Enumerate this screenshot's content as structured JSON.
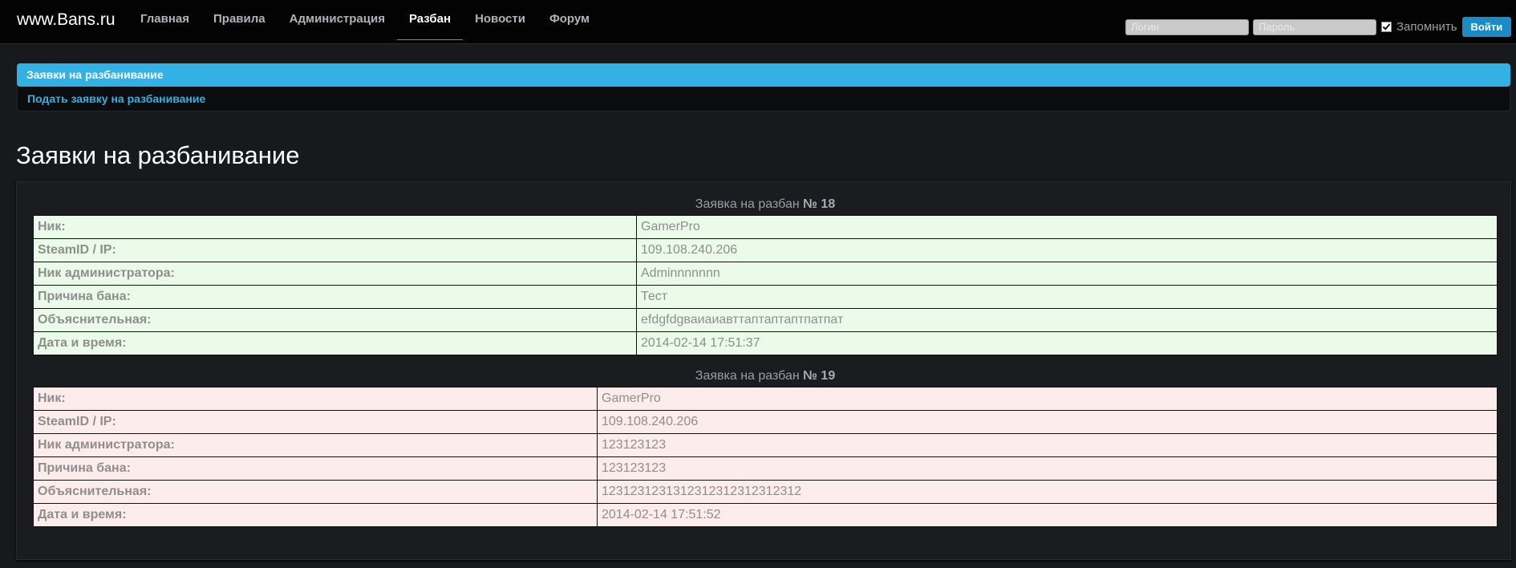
{
  "navbar": {
    "brand": "www.Bans.ru",
    "items": [
      {
        "label": "Главная"
      },
      {
        "label": "Правила"
      },
      {
        "label": "Администрация"
      },
      {
        "label": "Разбан"
      },
      {
        "label": "Новости"
      },
      {
        "label": "Форум"
      }
    ],
    "active": "Разбан",
    "login": {
      "login_placeholder": "Логин",
      "password_placeholder": "Пароль",
      "remember_label": "Запомнить",
      "remember_checked": true,
      "submit_label": "Войти"
    }
  },
  "menu": {
    "active_item": "Заявки на разбанивание",
    "link_item": "Подать заявку на разбанивание"
  },
  "page": {
    "title": "Заявки на разбанивание"
  },
  "requests": [
    {
      "caption_prefix": "Заявка на разбан",
      "number": "№ 18",
      "status_color": "#ebfbea",
      "rows": [
        {
          "label": "Ник:",
          "value": "GamerPro"
        },
        {
          "label": "SteamID / IP:",
          "value": "109.108.240.206"
        },
        {
          "label": "Ник администратора:",
          "value": "Adminnnnnnn"
        },
        {
          "label": "Причина бана:",
          "value": "Тест"
        },
        {
          "label": "Объяснительная:",
          "value": "efdgfdgваиаиавттаптаптаптпатпат"
        },
        {
          "label": "Дата и время:",
          "value": "2014-02-14 17:51:37"
        }
      ]
    },
    {
      "caption_prefix": "Заявка на разбан",
      "number": "№ 19",
      "status_color": "#fdecec",
      "rows": [
        {
          "label": "Ник:",
          "value": "GamerPro"
        },
        {
          "label": "SteamID / IP:",
          "value": "109.108.240.206"
        },
        {
          "label": "Ник администратора:",
          "value": "123123123"
        },
        {
          "label": "Причина бана:",
          "value": "123123123"
        },
        {
          "label": "Объяснительная:",
          "value": "1231231231312312312312312312"
        },
        {
          "label": "Дата и время:",
          "value": "2014-02-14 17:51:52"
        }
      ]
    }
  ],
  "colors": {
    "accent": "#33b1e5",
    "button": "#1b8bc6",
    "background": "#17191c"
  }
}
